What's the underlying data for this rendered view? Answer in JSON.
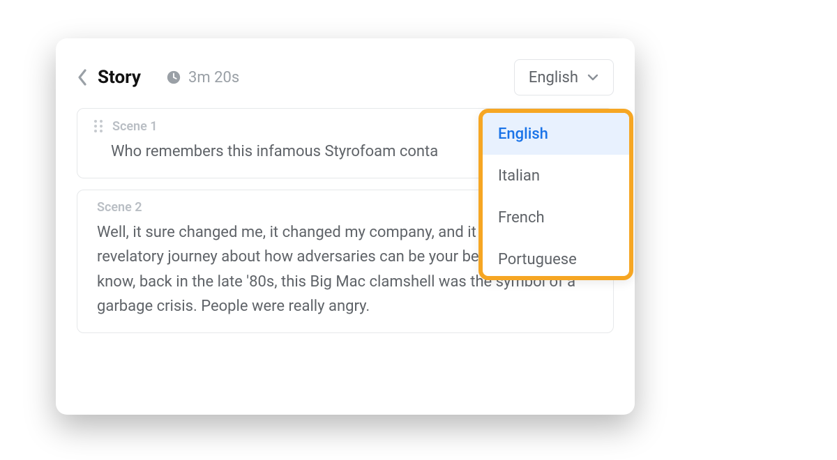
{
  "header": {
    "title": "Story",
    "duration": "3m 20s",
    "language_selected": "English"
  },
  "dropdown": {
    "items": [
      "English",
      "Italian",
      "French",
      "Portuguese"
    ],
    "selected_index": 0
  },
  "scenes": [
    {
      "label": "Scene 1",
      "text": "Who remembers this infamous Styrofoam conta"
    },
    {
      "label": "Scene 2",
      "text": "Well, it sure changed me, it changed my company, and it started a revelatory journey about how adversaries can be your best allies.   You know, back in the late '80s, this Big Mac clamshell was the symbol of a garbage crisis. People were really angry."
    }
  ]
}
